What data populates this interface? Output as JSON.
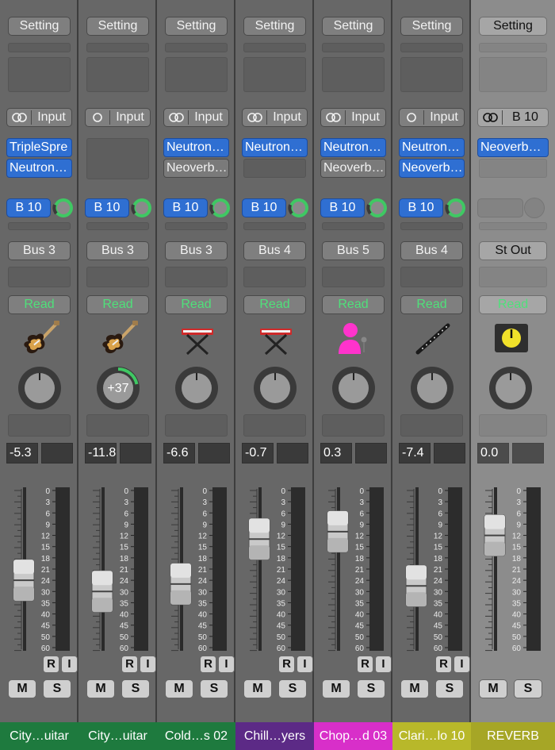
{
  "colors": {
    "send_blue": "#2f6fd2",
    "automation_green": "#4fe07a",
    "pan_arc_green": "#3fc863"
  },
  "strips": [
    {
      "setting": "Setting",
      "input": "Input",
      "input_mode": "stereo",
      "plugins": [
        {
          "label": "TripleSpre",
          "style": "blue"
        },
        {
          "label": "Neutron…",
          "style": "blue"
        }
      ],
      "send": "B 10",
      "output": "Bus 3",
      "automation": "Read",
      "icon": "electric-guitar-icon",
      "pan": 0,
      "pan_label": "",
      "peak": "-5.3",
      "fader_db": "-24",
      "name": "City…uitar",
      "name_color": "#1e7a3e"
    },
    {
      "setting": "Setting",
      "input": "Input",
      "input_mode": "mono",
      "plugins": [],
      "send": "B 10",
      "output": "Bus 3",
      "automation": "Read",
      "icon": "electric-guitar-icon",
      "pan": 37,
      "pan_label": "+37",
      "peak": "-11.8",
      "fader_db": "-30",
      "name": "City…uitar",
      "name_color": "#1e7a3e"
    },
    {
      "setting": "Setting",
      "input": "Input",
      "input_mode": "stereo",
      "plugins": [
        {
          "label": "Neutron…",
          "style": "blue"
        },
        {
          "label": "Neoverb…",
          "style": "gray"
        }
      ],
      "send": "B 10",
      "output": "Bus 3",
      "automation": "Read",
      "icon": "keyboard-stand-icon",
      "pan": 0,
      "pan_label": "",
      "peak": "-6.6",
      "fader_db": "-26",
      "name": "Cold…s 02",
      "name_color": "#1e7a3e"
    },
    {
      "setting": "Setting",
      "input": "Input",
      "input_mode": "stereo",
      "plugins": [
        {
          "label": "Neutron…",
          "style": "blue"
        }
      ],
      "send": "B 10",
      "output": "Bus 4",
      "automation": "Read",
      "icon": "keyboard-stand-icon",
      "pan": 0,
      "pan_label": "",
      "peak": "-0.7",
      "fader_db": "-13",
      "name": "Chill…yers",
      "name_color": "#5c2a86"
    },
    {
      "setting": "Setting",
      "input": "Input",
      "input_mode": "stereo",
      "plugins": [
        {
          "label": "Neutron…",
          "style": "blue"
        },
        {
          "label": "Neoverb…",
          "style": "gray"
        }
      ],
      "send": "B 10",
      "output": "Bus 5",
      "automation": "Read",
      "icon": "vocalist-icon",
      "pan": 0,
      "pan_label": "",
      "peak": "0.3",
      "fader_db": "-11",
      "name": "Chop…d 03",
      "name_color": "#d82fc9"
    },
    {
      "setting": "Setting",
      "input": "Input",
      "input_mode": "mono",
      "plugins": [
        {
          "label": "Neutron…",
          "style": "blue"
        },
        {
          "label": "Neoverb…",
          "style": "blue"
        }
      ],
      "send": "B 10",
      "output": "Bus 4",
      "automation": "Read",
      "icon": "clarinet-icon",
      "pan": 0,
      "pan_label": "",
      "peak": "-7.4",
      "fader_db": "-27",
      "name": "Clari…lo 10",
      "name_color": "#b8b82a"
    },
    {
      "setting": "Setting",
      "input": "B 10",
      "input_mode": "stereo",
      "plugins": [
        {
          "label": "Neoverb…",
          "style": "blue"
        }
      ],
      "send": "",
      "output": "St Out",
      "automation": "Read",
      "icon": "aux-knob-icon",
      "pan": 0,
      "pan_label": "",
      "peak": "0.0",
      "fader_db": "-12",
      "name": "REVERB",
      "name_color": "#a6a626",
      "aux": true
    }
  ],
  "scale_labels": [
    "0",
    "3",
    "6",
    "9",
    "12",
    "15",
    "18",
    "21",
    "24",
    "30",
    "35",
    "40",
    "45",
    "50",
    "60"
  ],
  "ri_labels": {
    "r": "R",
    "i": "I"
  },
  "ms_labels": {
    "m": "M",
    "s": "S"
  }
}
